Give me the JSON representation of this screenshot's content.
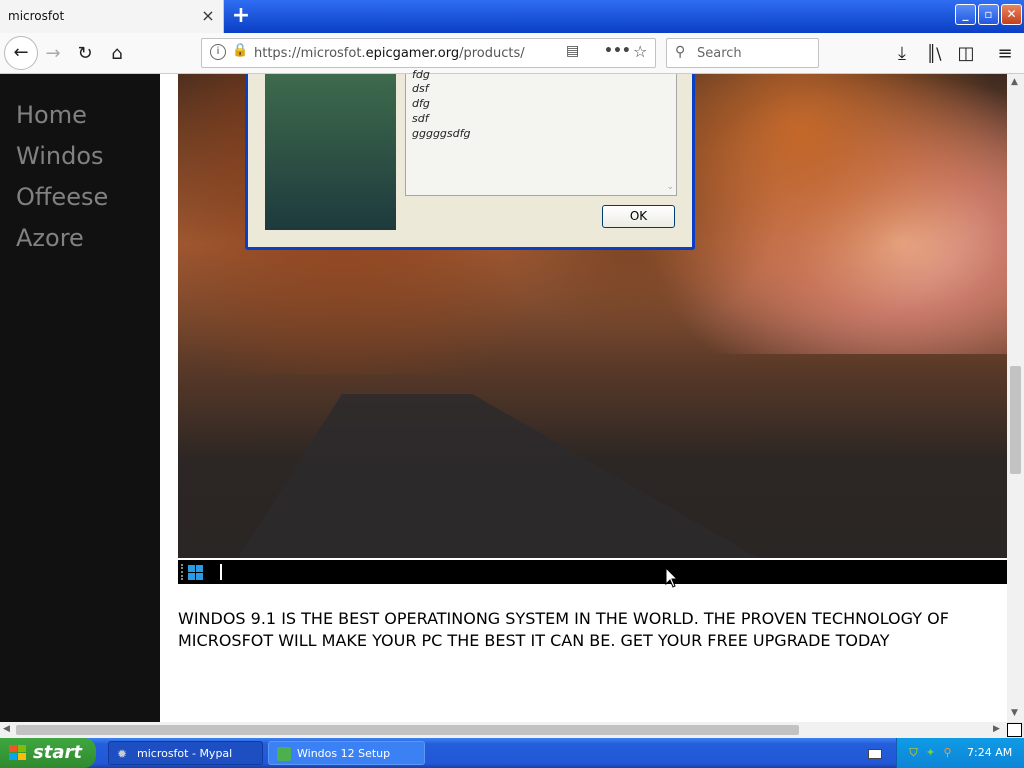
{
  "browser": {
    "tab_title": "microsfot",
    "tab_close": "×",
    "new_tab": "+",
    "url_prefix": "https://microsfot.",
    "url_domain": "epicgamer.org",
    "url_path": "/products/",
    "search_placeholder": "Search"
  },
  "window_controls": {
    "minimize": "_",
    "maximize": "▫",
    "close": "✕"
  },
  "sidenav": {
    "items": [
      "Home",
      "Windos",
      "Offeese",
      "Azore"
    ]
  },
  "dialog": {
    "list_items": [
      "fdg",
      "dsf",
      "dfg",
      "sdf",
      "gggggsdfg"
    ],
    "ok_label": "OK"
  },
  "promo_text": "WINDOS 9.1 IS THE BEST OPERATINONG SYSTEM IN THE WORLD. THE PROVEN TECHNOLOGY OF MICROSFOT WILL MAKE YOUR PC THE BEST IT CAN BE. GET YOUR FREE UPGRADE TODAY",
  "taskbar": {
    "start_label": "start",
    "items": [
      {
        "label": "microsfot - Mypal"
      },
      {
        "label": "Windos 12 Setup"
      }
    ],
    "clock": "7:24 AM"
  },
  "colors": {
    "xp_blue": "#245edb",
    "start_green": "#3fa73f",
    "sidenav_bg": "#111111",
    "sidenav_text": "#818181"
  }
}
